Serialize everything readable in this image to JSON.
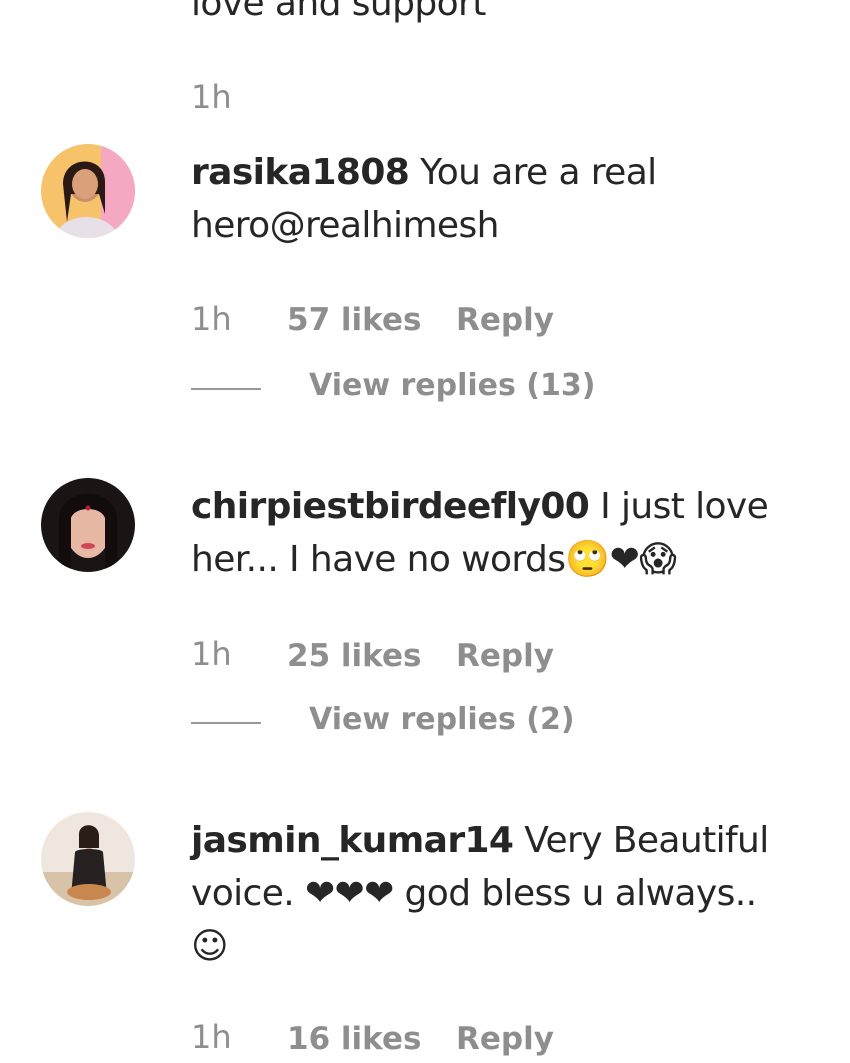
{
  "top_comment": {
    "text_tail": "love and support",
    "time": "1h"
  },
  "comments": [
    {
      "username": "rasika1808",
      "text": " You are a real hero@realhimesh",
      "time": "1h",
      "likes": "57 likes",
      "reply_label": "Reply",
      "view_replies": "View replies (13)"
    },
    {
      "username": "chirpiestbirdeefly00",
      "text_line1": " I just love",
      "text_line2": "her... I have no words",
      "emoji": [
        "🙄",
        "❤",
        "😱"
      ],
      "time": "1h",
      "likes": "25 likes",
      "reply_label": "Reply",
      "view_replies": "View replies (2)"
    },
    {
      "username": "jasmin_kumar14",
      "text_line1": " Very Beautiful",
      "text_line2_a": "voice. ",
      "hearts": "❤❤❤",
      "text_line2_b": " god bless u always..",
      "emoji_line3": "☺",
      "time": "1h",
      "likes": "16 likes",
      "reply_label": "Reply"
    }
  ]
}
